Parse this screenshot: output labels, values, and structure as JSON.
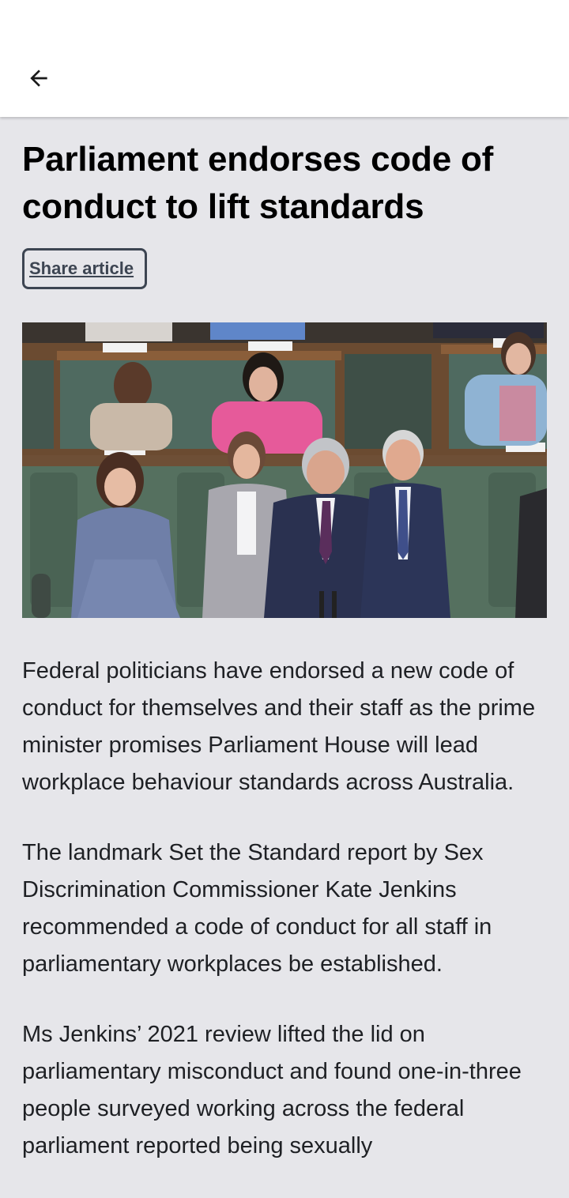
{
  "nav": {
    "back_icon": "arrow-left-icon"
  },
  "article": {
    "headline": "Parliament endorses code of conduct to lift standards",
    "share_label": "Share article",
    "paragraphs": [
      "Federal politicians have endorsed a new code of conduct for themselves and their staff as the prime minister promises Parliament House will lead workplace behaviour standards across Australia.",
      "The landmark Set the Standard report by Sex Discrimination Commissioner Kate Jenkins recommended a code of conduct for all staff in parliamentary workplaces be established.",
      "Ms Jenkins’ 2021 review lifted the lid on parliamentary misconduct and found one-in-three people surveyed working across the federal parliament reported being sexually"
    ]
  },
  "colors": {
    "background": "#e6e6ea",
    "app_bar": "#ffffff",
    "text": "#1e2024",
    "button_border": "#3d4552"
  }
}
